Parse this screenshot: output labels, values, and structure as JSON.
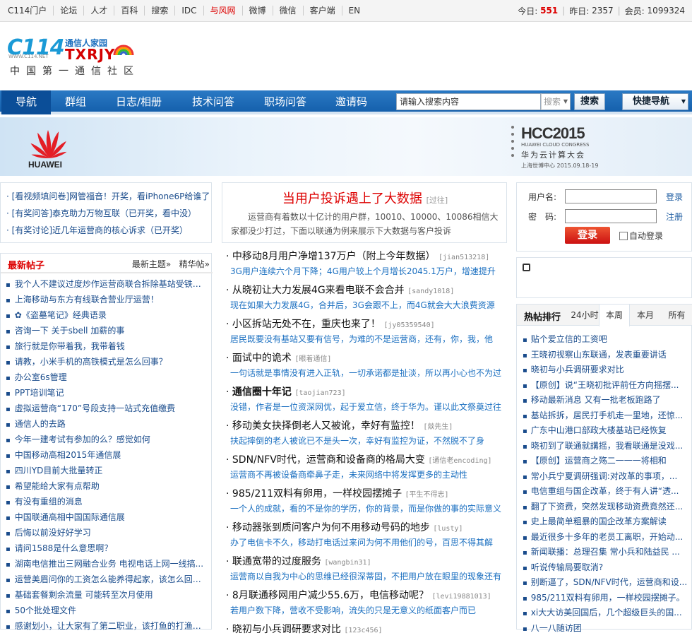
{
  "topbar": {
    "links": [
      "C114门户",
      "论坛",
      "人才",
      "百科",
      "搜索",
      "IDC",
      "与风网",
      "微博",
      "微信",
      "客户端",
      "EN"
    ],
    "today_label": "今日:",
    "today_value": "551",
    "yesterday_label": "昨日:",
    "yesterday_value": "2357",
    "members_label": "会员:",
    "members_value": "1099324"
  },
  "logo": {
    "brand": "C114",
    "url": "WWW.C114.NET",
    "cn_name": "通信人家园",
    "tx": "TXRJY",
    "slogan": "中国第一通信社区"
  },
  "nav": {
    "items": [
      "导航",
      "群组",
      "日志/相册",
      "技术问答",
      "职场问答",
      "邀请码"
    ],
    "search_placeholder": "请输入搜索内容",
    "search_select": "搜索",
    "search_button": "搜索",
    "quick_nav": "快捷导航"
  },
  "banner": {
    "brand": "HUAWEI",
    "event": "HCC2015",
    "event_en": "HUAWEI CLOUD CONGRESS",
    "event_cn": "华为云计算大会",
    "event_date": "上海世博中心 2015.09.18-19"
  },
  "lead": [
    "[看视频填问卷]网管福音！开奖，看iPhone6P给谁了",
    "[有奖问答]泰克助力万物互联（已开奖，看中没）",
    "[有奖讨论]近几年运营商的核心诉求（已开奖）"
  ],
  "newposts": {
    "title": "最新帖子",
    "tab1": "最新主题»",
    "tab2": "精华帖»",
    "items": [
      "我个人不建议过度炒作运营商联合拆除基站受铁塔...",
      "上海移动与东方有线联合营业厅运营！",
      "✿《盗墓笔记》经典语录",
      "咨询一下 关于sbell 加薪的事",
      "旅行就是你带着我，我带着钱",
      "请教，小米手机的高铁模式是怎么回事？",
      "办公室6s管理",
      "PPT培训笔记",
      "虚拟运营商“170”号段支持一站式充值缴费",
      "通信人的去路",
      "今年一建考试有参加的么？感觉如何",
      "中国移动高相2015年通信展",
      "四川YD目前大批量转正",
      "希望能给大家有点帮助",
      "有没有重组的消息",
      "中国联通高相中国国际通信展",
      "后悔以前没好好学习",
      "请问1588是什么意思啊？",
      "湖南电信推出三网融合业务 电视电话上网一线搞...",
      "运营美眉问你的工资怎么能养得起家，该怎么回答...",
      "基础套餐剩余流量 可能转至次月使用",
      "50个批处理文件",
      "感谢划小，让大家有了第二职业，该打鱼的打渔，该..."
    ]
  },
  "featured": {
    "title": "当用户投诉遇上了大数据",
    "tag": "[过往]",
    "desc": "运营商有着数以十亿计的用户群，10010、10000、10086相信大家都没少打过，下面以联通为例来展示下大数据与客户投诉"
  },
  "articles": [
    {
      "title": "中移动8月用户净增137万户（附上今年数据）",
      "author": "[jian513218]",
      "summary": "3G用户连续六个月下降；4G用户较上个月增长2045.1万户，增速提升",
      "bold": false
    },
    {
      "title": "从晓初让大力发展4G来看电联不会合并",
      "author": "[sandy1018]",
      "summary": "现在如果大力发展4G，合并后，3G会跟不上，而4G就会大大浪费资源",
      "bold": false
    },
    {
      "title": "小区拆站无处不在，重庆也来了！",
      "author": "[jy05359540]",
      "summary": "居民既要没有基站又要有信号，为难的不是运营商，还有，你，我，他",
      "bold": false
    },
    {
      "title": "面试中的诡术",
      "author": "[眼着通信]",
      "summary": "一句话就是事情没有进入正轨，一切承诺都是扯淡，所以再小心也不为过",
      "bold": false
    },
    {
      "title": "通信圈十年记",
      "author": "[taojian723]",
      "summary": "没错，作者是一位资深网优，起于爱立信，终于华为。谨以此文祭奠过往",
      "bold": true
    },
    {
      "title": "移动美女抉择倒老人又被讹，幸好有监控！",
      "author": "[燚先生]",
      "summary": "扶起摔倒的老人被讹已不是头一次，幸好有监控为证，不然脱不了身",
      "bold": false
    },
    {
      "title": "SDN/NFV时代，运营商和设备商的格局大变",
      "author": "[通信老encoding]",
      "summary": "运营商不再被设备商牵鼻子走，未来网络中将发挥更多的主动性",
      "bold": false
    },
    {
      "title": "985/211双料有卵用，一样校园摆摊子",
      "author": "[平生不得志]",
      "summary": "一个人的成就，看的不是你的学历，你的背景，而是你做的事的实际意义",
      "bold": false
    },
    {
      "title": "移动器张到质问客户为何不用移动号码的地步",
      "author": "[lusty]",
      "summary": "办了电信卡不久，移动打电话过来问为何不用他们的号，百思不得其解",
      "bold": false
    },
    {
      "title": "联通宽带的过度服务",
      "author": "[wangbin31]",
      "summary": "运营商以自我为中心的思维已经很深蒂固，不把用户放在眼里的现象还有",
      "bold": false
    },
    {
      "title": "8月联通移网用户减少55.6万，电信移动呢？",
      "author": "[levi19881013]",
      "summary": "若用户数下降，营收不受影响，流失的只是无意义的纸面客户而已",
      "bold": false
    },
    {
      "title": "晓初与小兵调研要求对比",
      "author": "[123c456]",
      "summary": "",
      "bold": false
    }
  ],
  "login": {
    "user_label": "用户名:",
    "pass_label": "密　码:",
    "register": "注册",
    "login_link": "登录",
    "button": "登录",
    "auto": "自动登录"
  },
  "hot": {
    "title": "热帖排行",
    "tabs": [
      "24小时",
      "本周",
      "本月",
      "所有"
    ],
    "items": [
      "贴个爱立信的工资吧",
      "王晓初视察山东联通，发表重要讲话",
      "晓初与小兵调研要求对比",
      "【原创】说“王晓初批评前任方向摇摆...",
      "移动最新消息 又有一批老板跑路了",
      "基站拆拆，居民打手机走一里地，还惊...",
      "广东中山港口部政大楼基站已经恢复",
      "晓初到了联通就講摇，我看联通是没戏...",
      "【原创】运营商之殇二一一一将相和",
      "常小兵宁夏调研强调:对改革的事项，...",
      "电信重组与国企改革，终于有人讲“透...",
      "翻了下资费，突然发现移动资费竟然还...",
      "史上最简单粗暴的国企改革方案解读",
      "最近很多十多年的老员工离职，开始动...",
      "新闻联播：总理召集 常小兵和陆益民 ...",
      "听说传输局要取消?",
      "别断逼了，SDN/NFV时代，运营商和设...",
      "985/211双料有卵用，一样校园摆摊子。",
      "xi大大访美回国后，几个超级巨头的国...",
      "八一八随访团"
    ]
  }
}
